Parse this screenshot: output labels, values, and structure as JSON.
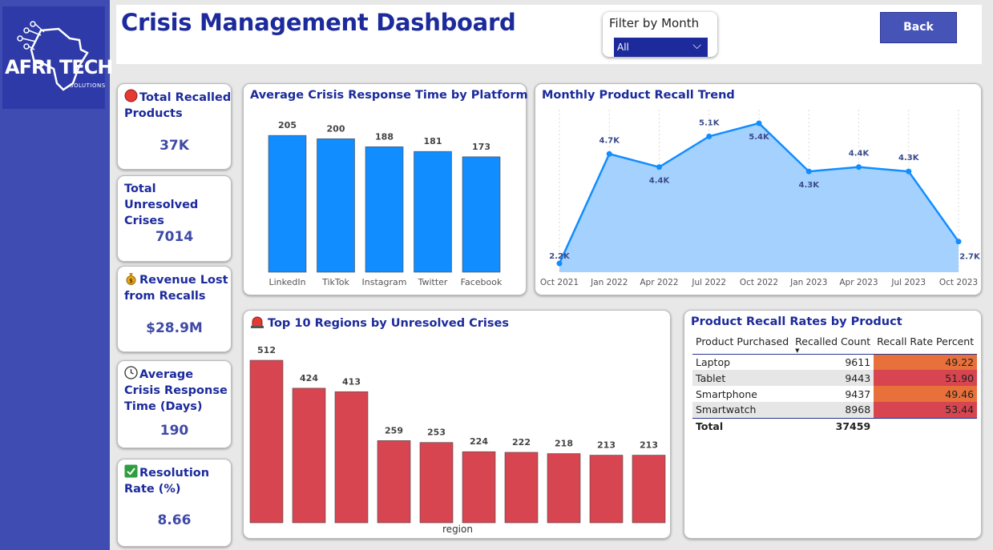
{
  "header": {
    "title": "Crisis Management Dashboard",
    "filter_label": "Filter by Month",
    "filter_value": "All",
    "back_label": "Back"
  },
  "logo": {
    "part1": "AFRI",
    "part2": "TECH",
    "sub": "SOLUTIONS"
  },
  "kpis": [
    {
      "title": "Total Recalled Products",
      "value": "37K",
      "icon": "red-circle-icon"
    },
    {
      "title": "Total Unresolved Crises",
      "value": "7014",
      "icon": ""
    },
    {
      "title": "Revenue Lost from Recalls",
      "value": "$28.9M",
      "icon": "money-bag-icon"
    },
    {
      "title": "Average Crisis Response Time (Days)",
      "value": "190",
      "icon": "clock-icon"
    },
    {
      "title": "Resolution Rate (%)",
      "value": "8.66",
      "icon": "check-box-icon"
    }
  ],
  "colors": {
    "accent": "#1c2a9c",
    "bar_blue": "#118dff",
    "bar_red": "#d64550",
    "area_fill": "#a0cfff",
    "orange": "#e8703a",
    "red_cell": "#d64550"
  },
  "chart_data": [
    {
      "type": "bar",
      "title": "Average Crisis Response Time by Platform",
      "categories": [
        "LinkedIn",
        "TikTok",
        "Instagram",
        "Twitter",
        "Facebook"
      ],
      "values": [
        205,
        200,
        188,
        181,
        173
      ],
      "ylim": [
        0,
        210
      ],
      "grid": false
    },
    {
      "type": "area",
      "title": "Monthly Product Recall Trend",
      "x_ticks": [
        "Oct 2021",
        "Jan 2022",
        "Apr 2022",
        "Jul 2022",
        "Oct 2022",
        "Jan 2023",
        "Apr 2023",
        "Jul 2023",
        "Oct 2023"
      ],
      "points": [
        {
          "x": "Oct 2021",
          "value": 2.2,
          "label": "2.2K"
        },
        {
          "x": "Jan 2022",
          "value": 4.7,
          "label": "4.7K"
        },
        {
          "x": "Apr 2022",
          "value": 4.4,
          "label": "4.4K"
        },
        {
          "x": "Jul 2022",
          "value": 5.1,
          "label": "5.1K"
        },
        {
          "x": "Oct 2022",
          "value": 5.4,
          "label": "5.4K"
        },
        {
          "x": "Jan 2023",
          "value": 4.3,
          "label": "4.3K"
        },
        {
          "x": "Apr 2023",
          "value": 4.4,
          "label": "4.4K"
        },
        {
          "x": "Jul 2023",
          "value": 4.3,
          "label": "4.3K"
        },
        {
          "x": "Oct 2023",
          "value": 2.7,
          "label": "2.7K"
        }
      ],
      "ylim": [
        2,
        5.6
      ],
      "grid": "vertical-dotted"
    },
    {
      "type": "bar",
      "title": "Top 10 Regions by Unresolved Crises",
      "xlabel": "region",
      "values": [
        512,
        424,
        413,
        259,
        253,
        224,
        222,
        218,
        213,
        213
      ],
      "ylim": [
        0,
        512
      ],
      "grid": false
    },
    {
      "type": "table",
      "title": "Product Recall Rates by Product",
      "columns": [
        "Product Purchased",
        "Recalled Count",
        "Recall Rate Percent"
      ],
      "rows": [
        {
          "product": "Laptop",
          "count": "9611",
          "rate": "49.22",
          "rate_color": "#e8703a"
        },
        {
          "product": "Tablet",
          "count": "9443",
          "rate": "51.90",
          "rate_color": "#d64550"
        },
        {
          "product": "Smartphone",
          "count": "9437",
          "rate": "49.46",
          "rate_color": "#e8703a"
        },
        {
          "product": "Smartwatch",
          "count": "8968",
          "rate": "53.44",
          "rate_color": "#d64550"
        }
      ],
      "total_label": "Total",
      "total_count": "37459"
    }
  ]
}
